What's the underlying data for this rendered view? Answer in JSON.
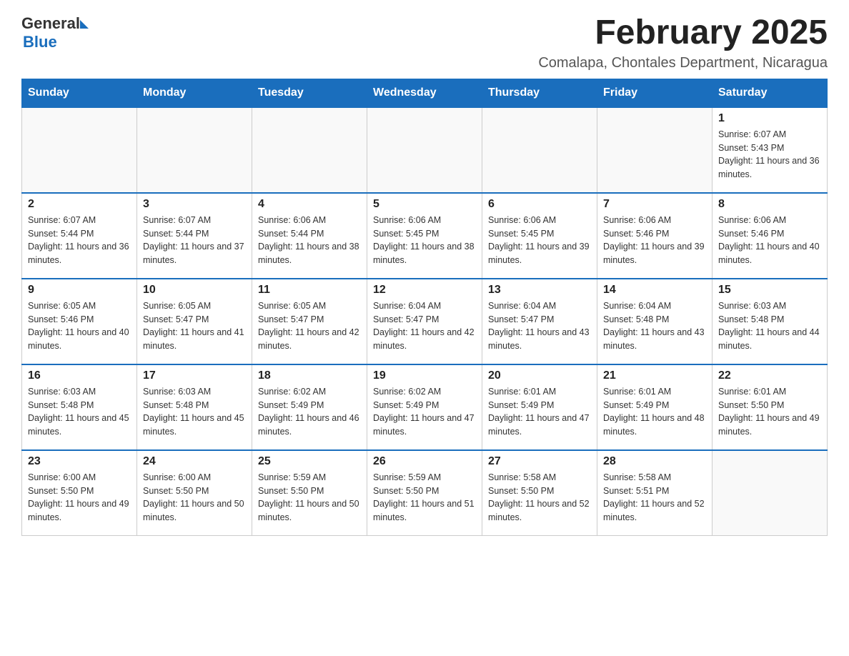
{
  "logo": {
    "general": "General",
    "blue": "Blue"
  },
  "header": {
    "month": "February 2025",
    "location": "Comalapa, Chontales Department, Nicaragua"
  },
  "days_of_week": [
    "Sunday",
    "Monday",
    "Tuesday",
    "Wednesday",
    "Thursday",
    "Friday",
    "Saturday"
  ],
  "weeks": [
    [
      {
        "day": "",
        "sunrise": "",
        "sunset": "",
        "daylight": ""
      },
      {
        "day": "",
        "sunrise": "",
        "sunset": "",
        "daylight": ""
      },
      {
        "day": "",
        "sunrise": "",
        "sunset": "",
        "daylight": ""
      },
      {
        "day": "",
        "sunrise": "",
        "sunset": "",
        "daylight": ""
      },
      {
        "day": "",
        "sunrise": "",
        "sunset": "",
        "daylight": ""
      },
      {
        "day": "",
        "sunrise": "",
        "sunset": "",
        "daylight": ""
      },
      {
        "day": "1",
        "sunrise": "Sunrise: 6:07 AM",
        "sunset": "Sunset: 5:43 PM",
        "daylight": "Daylight: 11 hours and 36 minutes."
      }
    ],
    [
      {
        "day": "2",
        "sunrise": "Sunrise: 6:07 AM",
        "sunset": "Sunset: 5:44 PM",
        "daylight": "Daylight: 11 hours and 36 minutes."
      },
      {
        "day": "3",
        "sunrise": "Sunrise: 6:07 AM",
        "sunset": "Sunset: 5:44 PM",
        "daylight": "Daylight: 11 hours and 37 minutes."
      },
      {
        "day": "4",
        "sunrise": "Sunrise: 6:06 AM",
        "sunset": "Sunset: 5:44 PM",
        "daylight": "Daylight: 11 hours and 38 minutes."
      },
      {
        "day": "5",
        "sunrise": "Sunrise: 6:06 AM",
        "sunset": "Sunset: 5:45 PM",
        "daylight": "Daylight: 11 hours and 38 minutes."
      },
      {
        "day": "6",
        "sunrise": "Sunrise: 6:06 AM",
        "sunset": "Sunset: 5:45 PM",
        "daylight": "Daylight: 11 hours and 39 minutes."
      },
      {
        "day": "7",
        "sunrise": "Sunrise: 6:06 AM",
        "sunset": "Sunset: 5:46 PM",
        "daylight": "Daylight: 11 hours and 39 minutes."
      },
      {
        "day": "8",
        "sunrise": "Sunrise: 6:06 AM",
        "sunset": "Sunset: 5:46 PM",
        "daylight": "Daylight: 11 hours and 40 minutes."
      }
    ],
    [
      {
        "day": "9",
        "sunrise": "Sunrise: 6:05 AM",
        "sunset": "Sunset: 5:46 PM",
        "daylight": "Daylight: 11 hours and 40 minutes."
      },
      {
        "day": "10",
        "sunrise": "Sunrise: 6:05 AM",
        "sunset": "Sunset: 5:47 PM",
        "daylight": "Daylight: 11 hours and 41 minutes."
      },
      {
        "day": "11",
        "sunrise": "Sunrise: 6:05 AM",
        "sunset": "Sunset: 5:47 PM",
        "daylight": "Daylight: 11 hours and 42 minutes."
      },
      {
        "day": "12",
        "sunrise": "Sunrise: 6:04 AM",
        "sunset": "Sunset: 5:47 PM",
        "daylight": "Daylight: 11 hours and 42 minutes."
      },
      {
        "day": "13",
        "sunrise": "Sunrise: 6:04 AM",
        "sunset": "Sunset: 5:47 PM",
        "daylight": "Daylight: 11 hours and 43 minutes."
      },
      {
        "day": "14",
        "sunrise": "Sunrise: 6:04 AM",
        "sunset": "Sunset: 5:48 PM",
        "daylight": "Daylight: 11 hours and 43 minutes."
      },
      {
        "day": "15",
        "sunrise": "Sunrise: 6:03 AM",
        "sunset": "Sunset: 5:48 PM",
        "daylight": "Daylight: 11 hours and 44 minutes."
      }
    ],
    [
      {
        "day": "16",
        "sunrise": "Sunrise: 6:03 AM",
        "sunset": "Sunset: 5:48 PM",
        "daylight": "Daylight: 11 hours and 45 minutes."
      },
      {
        "day": "17",
        "sunrise": "Sunrise: 6:03 AM",
        "sunset": "Sunset: 5:48 PM",
        "daylight": "Daylight: 11 hours and 45 minutes."
      },
      {
        "day": "18",
        "sunrise": "Sunrise: 6:02 AM",
        "sunset": "Sunset: 5:49 PM",
        "daylight": "Daylight: 11 hours and 46 minutes."
      },
      {
        "day": "19",
        "sunrise": "Sunrise: 6:02 AM",
        "sunset": "Sunset: 5:49 PM",
        "daylight": "Daylight: 11 hours and 47 minutes."
      },
      {
        "day": "20",
        "sunrise": "Sunrise: 6:01 AM",
        "sunset": "Sunset: 5:49 PM",
        "daylight": "Daylight: 11 hours and 47 minutes."
      },
      {
        "day": "21",
        "sunrise": "Sunrise: 6:01 AM",
        "sunset": "Sunset: 5:49 PM",
        "daylight": "Daylight: 11 hours and 48 minutes."
      },
      {
        "day": "22",
        "sunrise": "Sunrise: 6:01 AM",
        "sunset": "Sunset: 5:50 PM",
        "daylight": "Daylight: 11 hours and 49 minutes."
      }
    ],
    [
      {
        "day": "23",
        "sunrise": "Sunrise: 6:00 AM",
        "sunset": "Sunset: 5:50 PM",
        "daylight": "Daylight: 11 hours and 49 minutes."
      },
      {
        "day": "24",
        "sunrise": "Sunrise: 6:00 AM",
        "sunset": "Sunset: 5:50 PM",
        "daylight": "Daylight: 11 hours and 50 minutes."
      },
      {
        "day": "25",
        "sunrise": "Sunrise: 5:59 AM",
        "sunset": "Sunset: 5:50 PM",
        "daylight": "Daylight: 11 hours and 50 minutes."
      },
      {
        "day": "26",
        "sunrise": "Sunrise: 5:59 AM",
        "sunset": "Sunset: 5:50 PM",
        "daylight": "Daylight: 11 hours and 51 minutes."
      },
      {
        "day": "27",
        "sunrise": "Sunrise: 5:58 AM",
        "sunset": "Sunset: 5:50 PM",
        "daylight": "Daylight: 11 hours and 52 minutes."
      },
      {
        "day": "28",
        "sunrise": "Sunrise: 5:58 AM",
        "sunset": "Sunset: 5:51 PM",
        "daylight": "Daylight: 11 hours and 52 minutes."
      },
      {
        "day": "",
        "sunrise": "",
        "sunset": "",
        "daylight": ""
      }
    ]
  ]
}
